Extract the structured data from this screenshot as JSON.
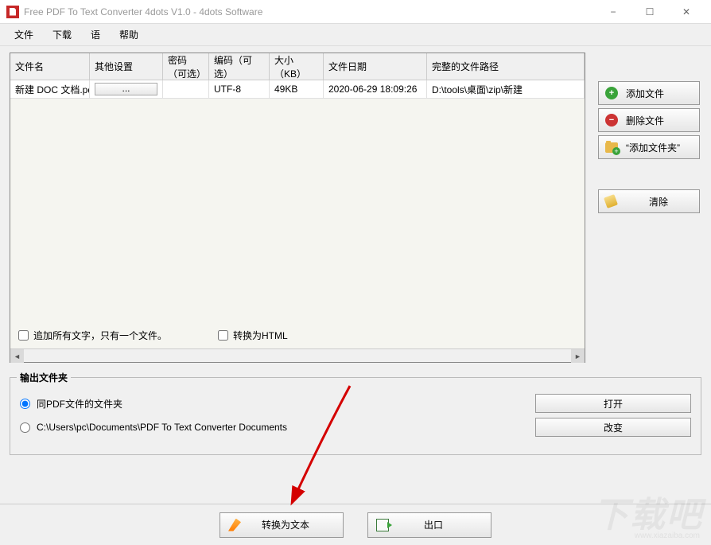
{
  "window": {
    "title": "Free PDF To Text Converter 4dots V1.0 - 4dots Software"
  },
  "menu": {
    "file": "文件",
    "download": "下载",
    "language": "语",
    "help": "帮助"
  },
  "table": {
    "headers": {
      "filename": "文件名",
      "other": "其他设置",
      "password": "密码（可选）",
      "encoding": "编码（可选）",
      "size": "大小（KB）",
      "date": "文件日期",
      "path": "完整的文件路径"
    },
    "rows": [
      {
        "filename": "新建 DOC 文档.pdf",
        "other_btn": "...",
        "password": "",
        "encoding": "UTF-8",
        "size": "49KB",
        "date": "2020-06-29 18:09:26",
        "path": "D:\\tools\\桌面\\zip\\新建"
      }
    ]
  },
  "options": {
    "append_text": "追加所有文字，只有一个文件。",
    "to_html": "转换为HTML"
  },
  "sidebar": {
    "add_file": "添加文件",
    "delete_file": "删除文件",
    "add_folder": "“添加文件夹”",
    "clear": "清除"
  },
  "output": {
    "group_title": "输出文件夹",
    "same_as_pdf": "同PDF文件的文件夹",
    "custom_path": "C:\\Users\\pc\\Documents\\PDF To Text Converter Documents",
    "open": "打开",
    "change": "改变"
  },
  "bottom": {
    "convert": "转换为文本",
    "exit": "出口"
  },
  "watermark": {
    "main": "下载吧",
    "sub": "www.xiazaiba.com"
  }
}
